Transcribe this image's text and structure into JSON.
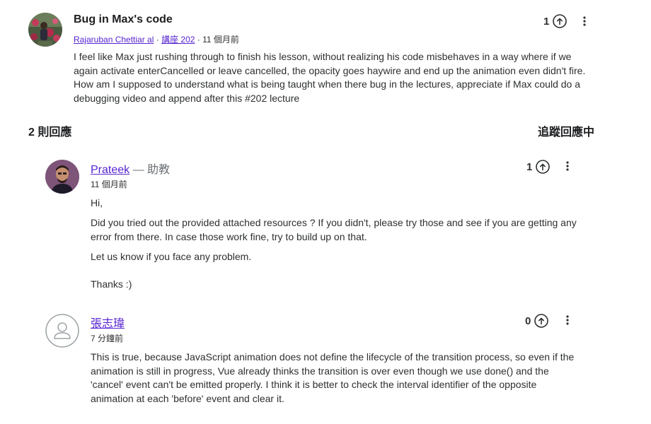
{
  "question": {
    "title": "Bug in Max's code",
    "author": "Rajaruban Chettiar al",
    "separator1": " · ",
    "lecture": "講座 202",
    "separator2": " · ",
    "time": "11 個月前",
    "body": "I feel like Max just rushing through to finish his lesson, without realizing his code misbehaves in a way where if we again activate enterCancelled or leave cancelled, the opacity goes haywire and end up the animation even didn't fire. How am I supposed to understand what is being taught when there bug in the lectures, appreciate if Max could do a debugging video and append after this #202 lecture",
    "votes": "1"
  },
  "replies_header": {
    "count_label": "2 則回應",
    "follow_label": "追蹤回應中"
  },
  "replies": [
    {
      "name": "Prateek",
      "role": " — 助教",
      "time": "11 個月前",
      "votes": "1",
      "paragraphs": [
        "Hi,",
        "Did you tried out the provided attached resources ? If you didn't, please try those and see if you are getting any error from there. In case those work fine, try to build up on that.",
        "Let us know if you face any problem.",
        "Thanks :)"
      ]
    },
    {
      "name": "張志瑋",
      "time": "7 分鐘前",
      "votes": "0",
      "paragraphs": [
        "This is true, because JavaScript animation does not define the lifecycle of the transition process, so even if the animation is still in progress, Vue already thinks the transition is over even though we use done() and the 'cancel' event can't be emitted properly. I think it is better to check the interval identifier of the opposite animation at each 'before' event and clear it."
      ]
    }
  ],
  "icons": {
    "upvote": "arrow-up-circle-icon",
    "more": "more-vertical-icon",
    "default_avatar": "user-icon"
  },
  "colors": {
    "link": "#5624d0",
    "text": "#2d2f31",
    "muted": "#6a6f73"
  }
}
